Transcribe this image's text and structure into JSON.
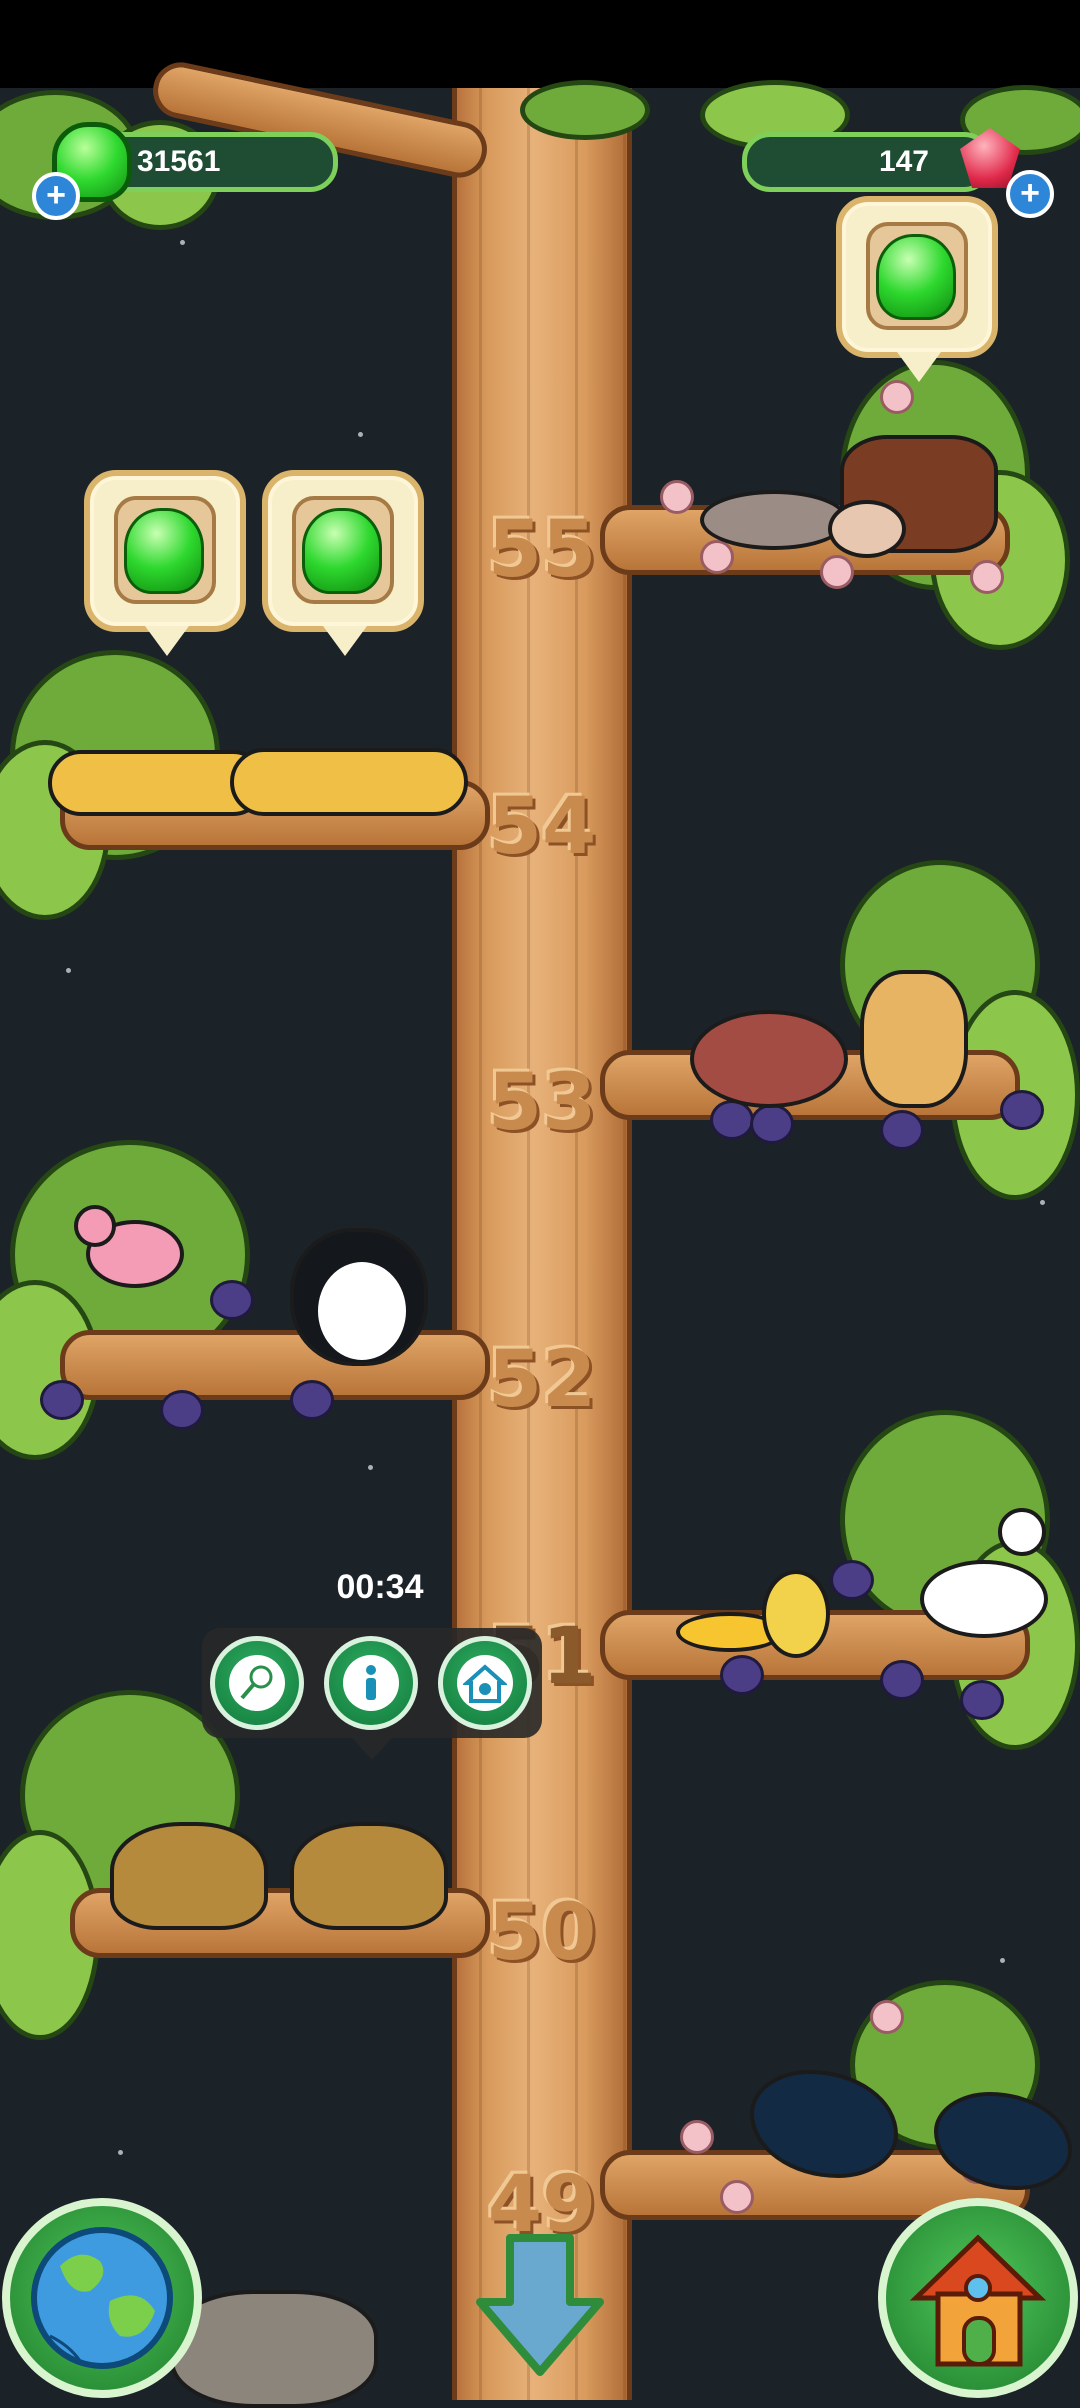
{
  "hud": {
    "jelly_count": "31561",
    "crystal_count": "147",
    "plus_symbol": "+"
  },
  "tree": {
    "levels": [
      "55",
      "54",
      "53",
      "52",
      "51",
      "50",
      "49"
    ]
  },
  "selected_branch": {
    "timer": "00:34",
    "actions": [
      "catch",
      "info",
      "home"
    ]
  },
  "colors": {
    "background": "#1b2228",
    "trunk": "#d89a5c",
    "leaf": "#6fab3a",
    "jelly": "#2ed82e",
    "action_button": "#127a3c"
  },
  "icons": {
    "jelly": "green-jelly-icon",
    "crystal": "red-crystal-icon",
    "catch": "butterfly-net-icon",
    "info": "info-icon",
    "home": "animal-house-icon",
    "globe": "globe-icon",
    "scroll_down": "arrow-down-icon",
    "house": "house-icon"
  }
}
